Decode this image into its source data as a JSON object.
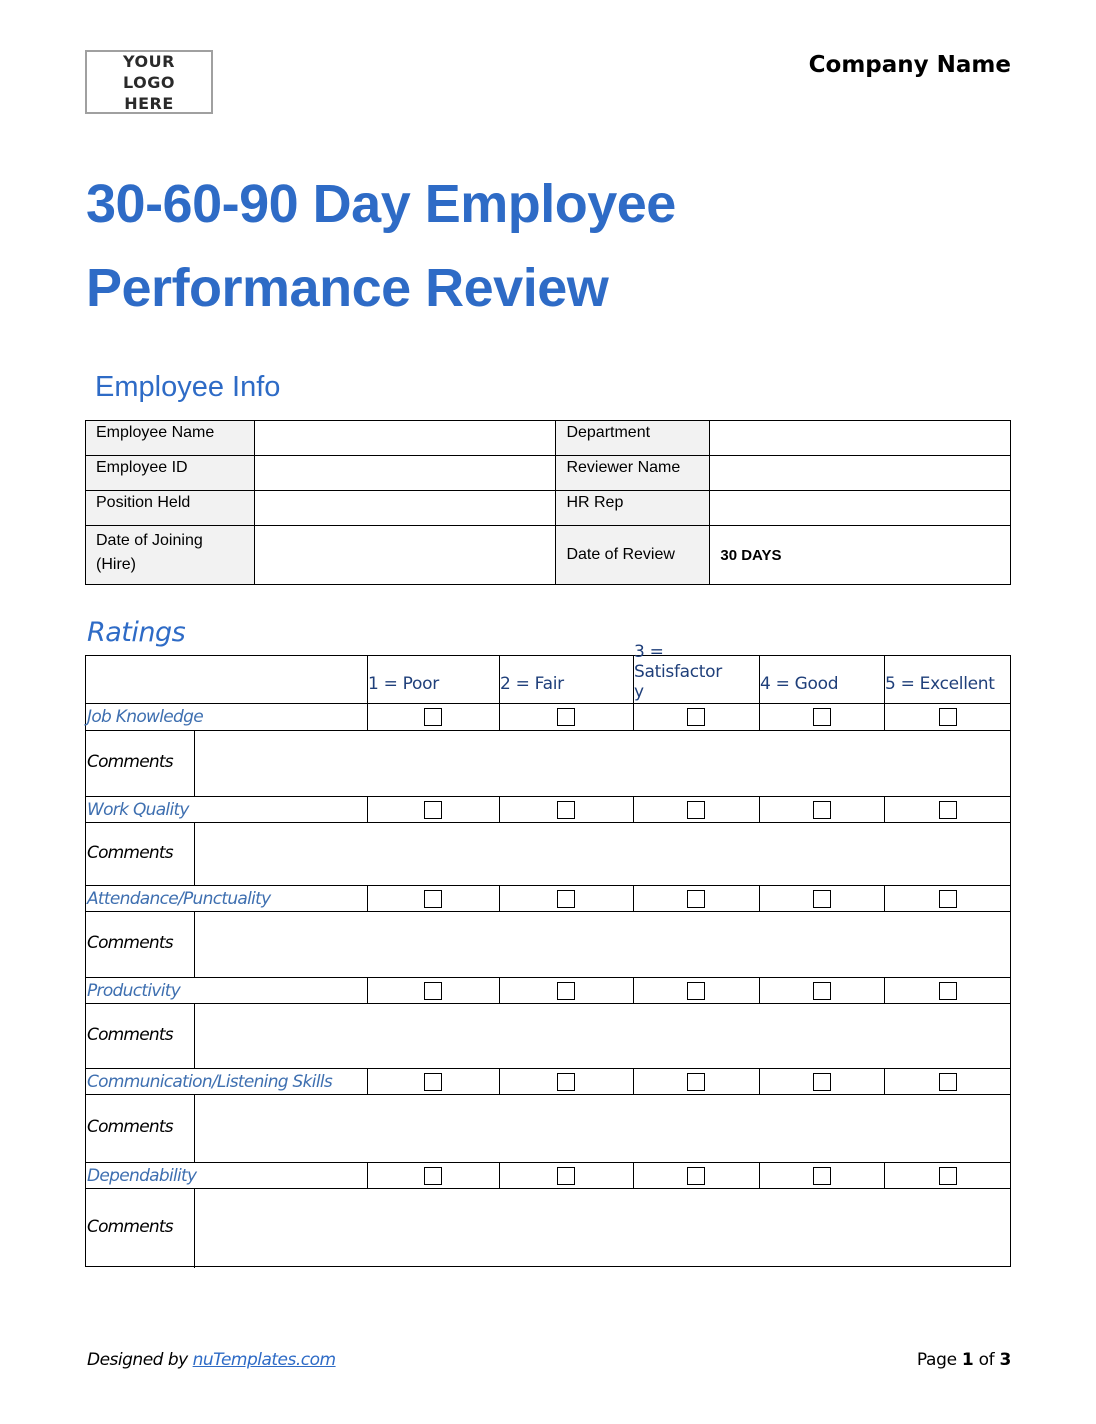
{
  "header": {
    "logo_text": "YOUR LOGO HERE",
    "company_name": "Company Name",
    "title_line1": "30-60-90 Day Employee",
    "title_line2": "Performance Review"
  },
  "employee_info": {
    "section_title": "Employee Info",
    "rows": [
      {
        "left_label": "Employee Name",
        "left_value": "",
        "right_label": "Department",
        "right_value": ""
      },
      {
        "left_label": "Employee ID",
        "left_value": "",
        "right_label": "Reviewer Name",
        "right_value": ""
      },
      {
        "left_label": "Position Held",
        "left_value": "",
        "right_label": "HR Rep",
        "right_value": ""
      },
      {
        "left_label": "Date of Joining (Hire)",
        "left_value": "",
        "right_label": "Date of Review",
        "right_value": "30 DAYS"
      }
    ]
  },
  "ratings": {
    "section_title": "Ratings",
    "scale": [
      "1 = Poor",
      "2 = Fair",
      "3 = Satisfactory",
      "4 = Good",
      "5 = Excellent"
    ],
    "comments_label": "Comments",
    "criteria": [
      {
        "name": "Job Knowledge",
        "selected": null,
        "comments": ""
      },
      {
        "name": "Work Quality",
        "selected": null,
        "comments": ""
      },
      {
        "name": "Attendance/Punctuality",
        "selected": null,
        "comments": ""
      },
      {
        "name": "Productivity",
        "selected": null,
        "comments": ""
      },
      {
        "name": "Communication/Listening Skills",
        "selected": null,
        "comments": ""
      },
      {
        "name": "Dependability",
        "selected": null,
        "comments": ""
      }
    ]
  },
  "footer": {
    "designed_by_label": "Designed by",
    "designer_link": "nuTemplates.com",
    "page_label": "Page",
    "page_current": "1",
    "page_of_label": "of",
    "page_total": "3"
  },
  "colors": {
    "title_blue": "#2e6bc6",
    "criteria_blue": "#3e6fb0",
    "scale_header_navy": "#1f3f7a",
    "label_cell_gray": "#f2f2f2"
  }
}
